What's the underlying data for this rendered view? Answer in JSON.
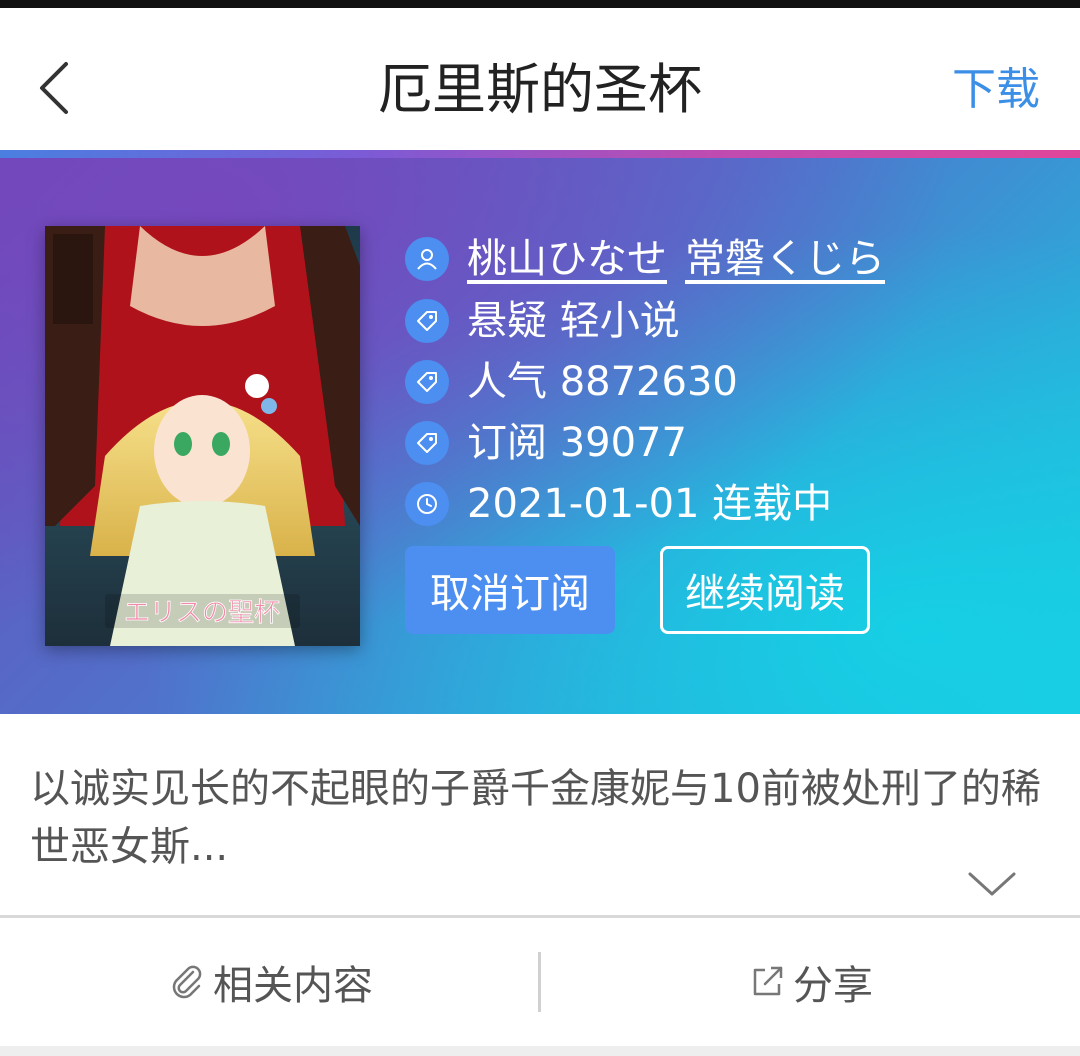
{
  "header": {
    "title": "厄里斯的圣杯",
    "download_label": "下载"
  },
  "book": {
    "cover_alt": "エリスの聖杯",
    "authors": [
      "桃山ひなせ",
      "常磐くじら"
    ],
    "tags": "悬疑 轻小说",
    "popularity": "人气 8872630",
    "subscriptions": "订阅 39077",
    "status": "2021-01-01 连载中"
  },
  "actions": {
    "unsubscribe_label": "取消订阅",
    "continue_label": "继续阅读"
  },
  "description": {
    "text": "以诚实见长的不起眼的子爵千金康妮与10前被处刑了的稀世恶女斯..."
  },
  "bottom_bar": {
    "related_label": "相关内容",
    "share_label": "分享"
  },
  "colors": {
    "accent": "#4c8ff0",
    "link": "#3b8fe6"
  }
}
